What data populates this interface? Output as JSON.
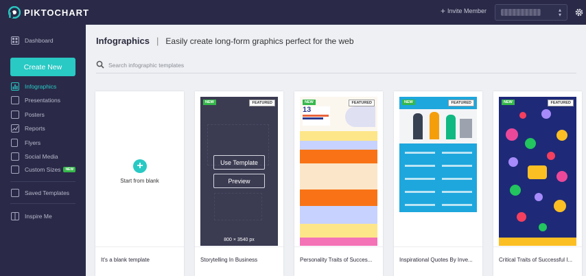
{
  "app": {
    "name": "PIKTOCHART"
  },
  "topbar": {
    "invite_label": "Invite Member"
  },
  "sidebar": {
    "dashboard": "Dashboard",
    "create_new": "Create New",
    "items": [
      {
        "label": "Infographics",
        "icon": "bar-chart-icon",
        "active": true
      },
      {
        "label": "Presentations",
        "icon": "presentation-icon"
      },
      {
        "label": "Posters",
        "icon": "poster-icon"
      },
      {
        "label": "Reports",
        "icon": "report-icon"
      },
      {
        "label": "Flyers",
        "icon": "flyer-icon"
      },
      {
        "label": "Social Media",
        "icon": "social-media-icon"
      },
      {
        "label": "Custom Sizes",
        "icon": "custom-sizes-icon",
        "badge": "NEW"
      }
    ],
    "saved_templates": "Saved Templates",
    "inspire_me": "Inspire Me"
  },
  "main": {
    "title": "Infographics",
    "subtitle": "Easily create long-form graphics perfect for the web",
    "search_placeholder": "Search infographic templates"
  },
  "cards": [
    {
      "name": "It's a blank template",
      "blank_label": "Start from blank"
    },
    {
      "name": "Storytelling In Business",
      "tag_new": "NEW",
      "tag_featured": "FEATURED",
      "use_template": "Use Template",
      "preview": "Preview",
      "size": "800 × 3540 px"
    },
    {
      "name": "Personality Traits of Succes...",
      "tag_new": "NEW",
      "tag_featured": "FEATURED"
    },
    {
      "name": "Inspirational Quotes By Inve...",
      "tag_new": "NEW",
      "tag_featured": "FEATURED"
    },
    {
      "name": "Critical Traits of Successful I...",
      "tag_new": "NEW",
      "tag_featured": "FEATURED"
    }
  ],
  "colors": {
    "nav_bg": "#2a2a48",
    "accent": "#29c9c4",
    "new_badge": "#35b84a",
    "main_bg": "#eef0f4"
  }
}
